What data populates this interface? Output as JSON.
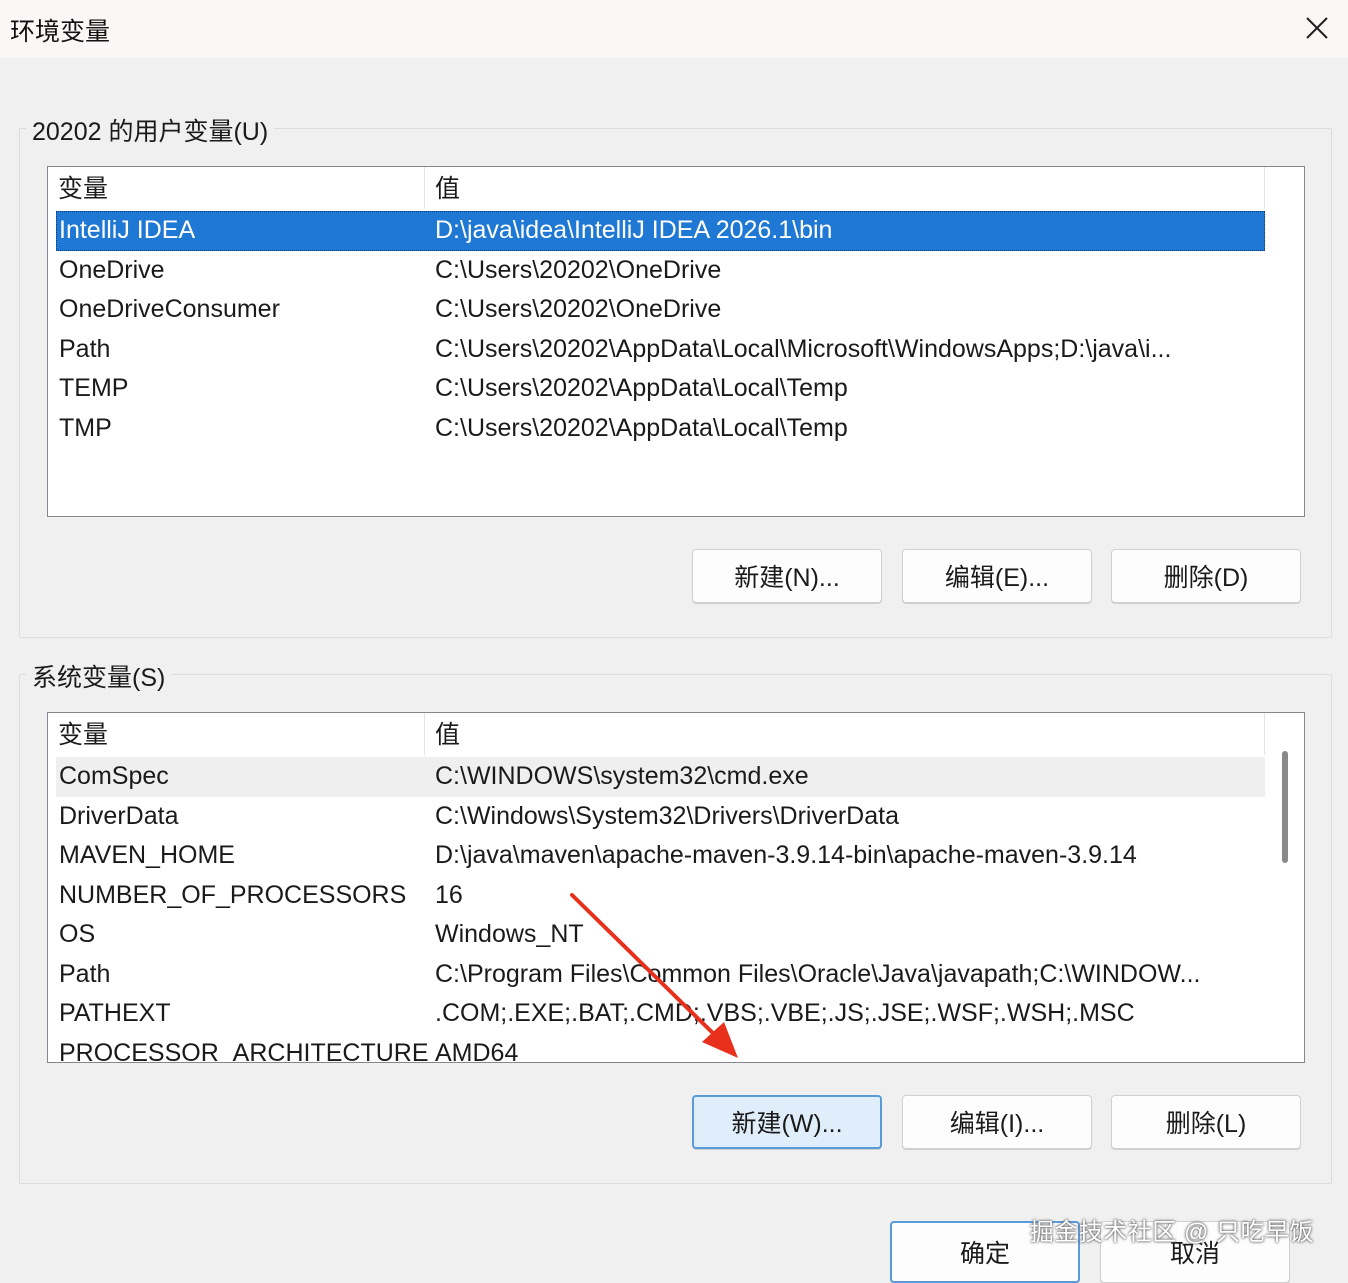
{
  "window": {
    "title": "环境变量"
  },
  "user_vars": {
    "legend": "20202 的用户变量(U)",
    "columns": [
      "变量",
      "值"
    ],
    "rows": [
      {
        "name": "IntelliJ IDEA",
        "value": "D:\\java\\idea\\IntelliJ IDEA 2026.1\\bin"
      },
      {
        "name": "OneDrive",
        "value": "C:\\Users\\20202\\OneDrive"
      },
      {
        "name": "OneDriveConsumer",
        "value": "C:\\Users\\20202\\OneDrive"
      },
      {
        "name": "Path",
        "value": "C:\\Users\\20202\\AppData\\Local\\Microsoft\\WindowsApps;D:\\java\\i..."
      },
      {
        "name": "TEMP",
        "value": "C:\\Users\\20202\\AppData\\Local\\Temp"
      },
      {
        "name": "TMP",
        "value": "C:\\Users\\20202\\AppData\\Local\\Temp"
      }
    ],
    "buttons": {
      "new": "新建(N)...",
      "edit": "编辑(E)...",
      "delete": "删除(D)"
    }
  },
  "system_vars": {
    "legend": "系统变量(S)",
    "columns": [
      "变量",
      "值"
    ],
    "rows": [
      {
        "name": "ComSpec",
        "value": "C:\\WINDOWS\\system32\\cmd.exe"
      },
      {
        "name": "DriverData",
        "value": "C:\\Windows\\System32\\Drivers\\DriverData"
      },
      {
        "name": "MAVEN_HOME",
        "value": "D:\\java\\maven\\apache-maven-3.9.14-bin\\apache-maven-3.9.14"
      },
      {
        "name": "NUMBER_OF_PROCESSORS",
        "value": "16"
      },
      {
        "name": "OS",
        "value": "Windows_NT"
      },
      {
        "name": "Path",
        "value": "C:\\Program Files\\Common Files\\Oracle\\Java\\javapath;C:\\WINDOW..."
      },
      {
        "name": "PATHEXT",
        "value": ".COM;.EXE;.BAT;.CMD;.VBS;.VBE;.JS;.JSE;.WSF;.WSH;.MSC"
      },
      {
        "name": "PROCESSOR_ARCHITECTURE",
        "value": "AMD64"
      }
    ],
    "buttons": {
      "new": "新建(W)...",
      "edit": "编辑(I)...",
      "delete": "删除(L)"
    }
  },
  "footer": {
    "ok": "确定",
    "cancel": "取消"
  },
  "watermark": "掘金技术社区 @ 只吃早饭",
  "colors": {
    "selection": "#1e78d4",
    "annotation_arrow": "#e8301c"
  },
  "icons": {
    "close": "close-icon"
  }
}
